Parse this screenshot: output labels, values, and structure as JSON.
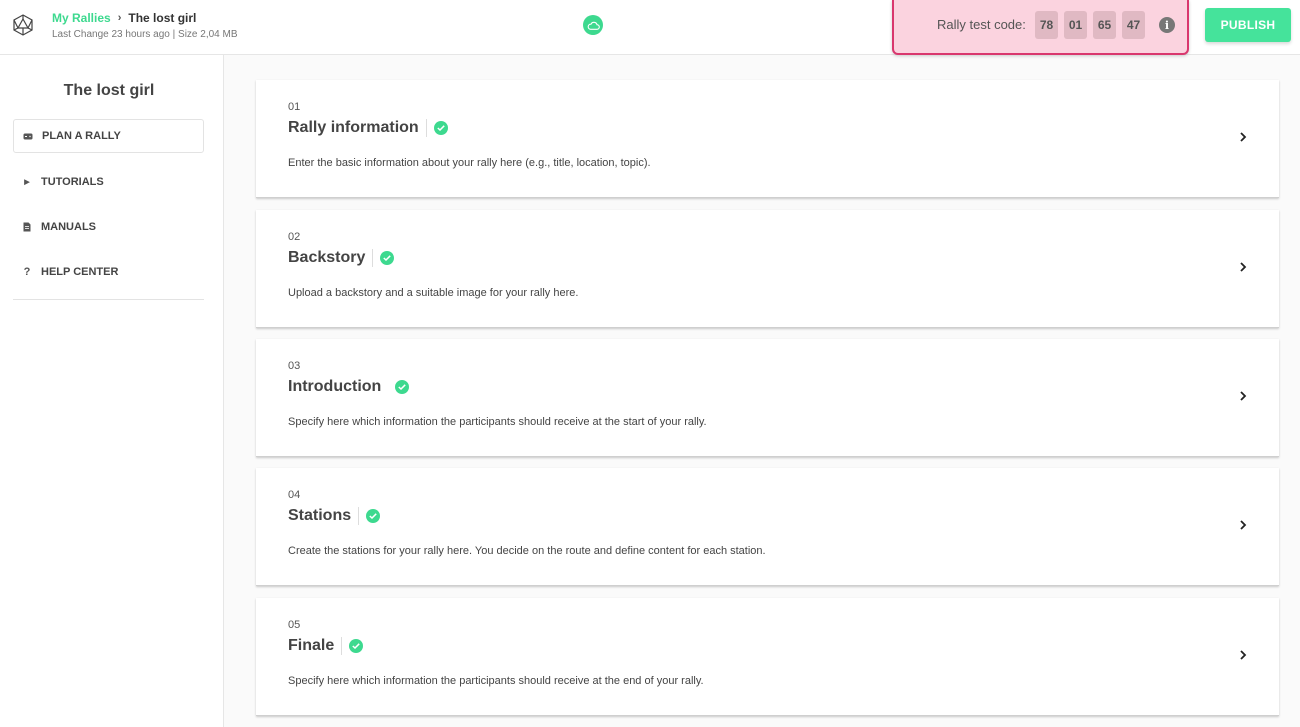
{
  "header": {
    "breadcrumb_link": "My Rallies",
    "breadcrumb_sep": "›",
    "breadcrumb_current": "The lost girl",
    "meta": "Last Change 23 hours ago | Size 2,04 MB",
    "test_code_label": "Rally test code:",
    "test_code_digits": [
      "78",
      "01",
      "65",
      "47"
    ],
    "info_glyph": "i",
    "publish_label": "PUBLISH"
  },
  "sidebar": {
    "title": "The lost girl",
    "items": [
      {
        "label": "PLAN A RALLY",
        "icon": "gamepad-icon",
        "glyph": "▬"
      },
      {
        "label": "TUTORIALS",
        "icon": "play-icon",
        "glyph": "▶"
      },
      {
        "label": "MANUALS",
        "icon": "document-icon",
        "glyph": "▤"
      },
      {
        "label": "HELP CENTER",
        "icon": "question-icon",
        "glyph": "?"
      }
    ]
  },
  "steps": [
    {
      "number": "01",
      "title": "Rally information",
      "description": "Enter the basic information about your rally here (e.g., title, location, topic)."
    },
    {
      "number": "02",
      "title": "Backstory",
      "description": "Upload a backstory and a suitable image for your rally here."
    },
    {
      "number": "03",
      "title": "Introduction",
      "description": "Specify here which information the participants should receive at the start of your rally."
    },
    {
      "number": "04",
      "title": "Stations",
      "description": "Create the stations for your rally here. You decide on the route and define content for each station."
    },
    {
      "number": "05",
      "title": "Finale",
      "description": "Specify here which information the participants should receive at the end of your rally."
    }
  ],
  "colors": {
    "accent": "#3dd98f",
    "publish": "#45e39b",
    "test_code_bg": "#fbd3df",
    "test_code_border": "#d9376e"
  }
}
